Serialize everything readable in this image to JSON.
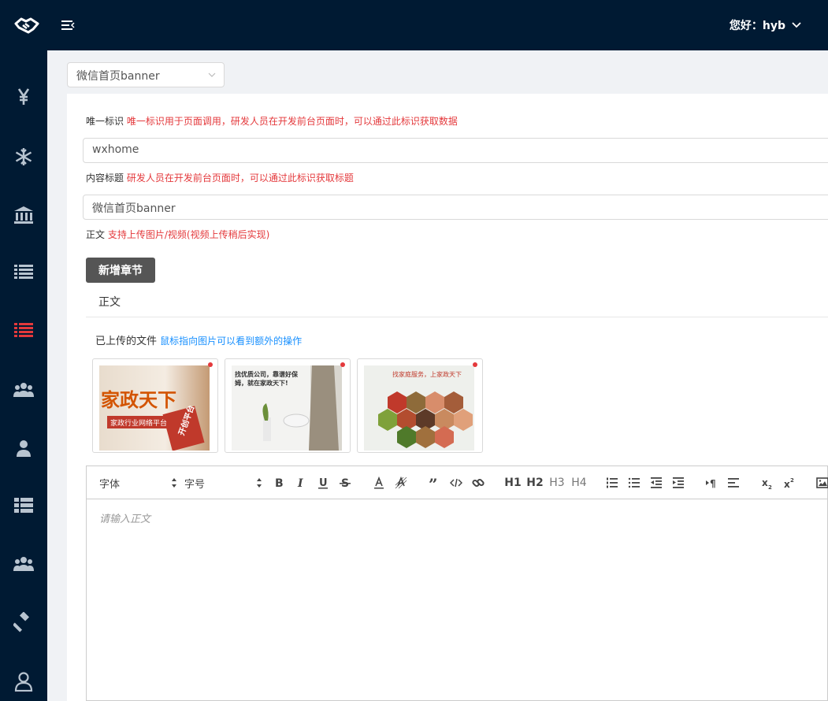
{
  "header": {
    "greeting": "您好：hyb"
  },
  "sidebar": {
    "items": [
      {
        "icon": "yen-icon"
      },
      {
        "icon": "snowflake-icon"
      },
      {
        "icon": "bank-icon"
      },
      {
        "icon": "list-icon"
      },
      {
        "icon": "list-active-icon",
        "active": true
      },
      {
        "icon": "users-icon"
      },
      {
        "icon": "user-icon"
      },
      {
        "icon": "list-alt-icon"
      },
      {
        "icon": "users-alt-icon"
      },
      {
        "icon": "gavel-icon"
      },
      {
        "icon": "user-outline-icon"
      }
    ],
    "active_color": "#e4393c"
  },
  "category_select": {
    "value": "微信首页banner"
  },
  "form": {
    "key_label": "唯一标识",
    "key_hint": "唯一标识用于页面调用，研发人员在开发前台页面时，可以通过此标识获取数据",
    "key_value": "wxhome",
    "title_label": "内容标题",
    "title_hint": "研发人员在开发前台页面时，可以通过此标识获取标题",
    "title_value": "微信首页banner",
    "body_label": "正文",
    "body_hint": "支持上传图片/视频(视频上传稍后实现)",
    "add_section_button": "新增章节",
    "section_tab": "正文"
  },
  "uploads": {
    "label": "已上传的文件",
    "hint": "鼠标指向图片可以看到额外的操作",
    "images": [
      {
        "alt_text": "家政天下",
        "sub_text": "家政行业网络平台",
        "badge_text": "开创平台"
      },
      {
        "alt_text": "找优质公司，靠谱好保姆，就在家政天下!"
      },
      {
        "alt_text": "找家庭服务，上家政天下"
      }
    ]
  },
  "editor": {
    "font_label": "字体",
    "size_label": "字号",
    "h1": "H1",
    "h2": "H2",
    "h3": "H3",
    "h4": "H4",
    "placeholder": "请输入正文"
  }
}
